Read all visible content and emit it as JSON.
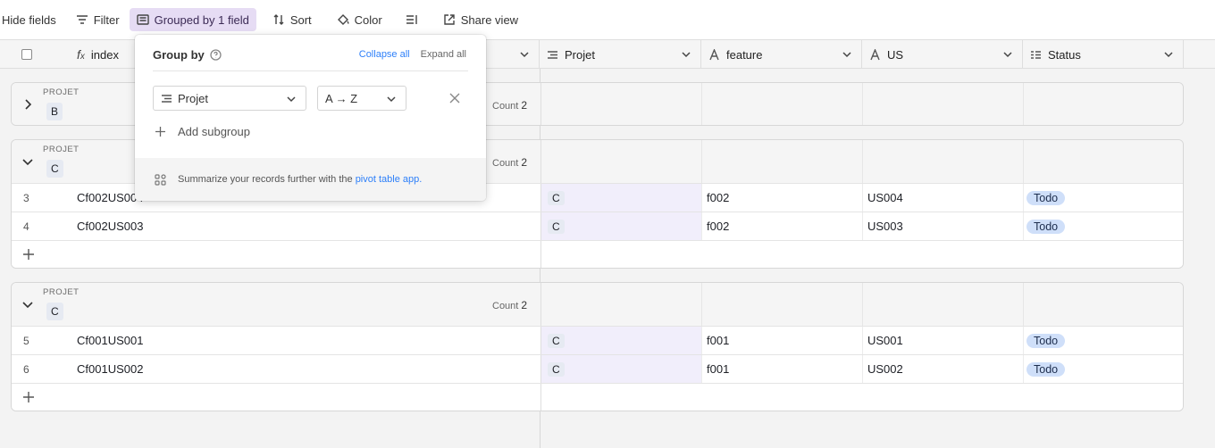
{
  "toolbar": {
    "hide_fields": "Hide fields",
    "filter": "Filter",
    "grouped": "Grouped by 1 field",
    "sort": "Sort",
    "color": "Color",
    "share": "Share view"
  },
  "columns": {
    "index": "index",
    "projet": "Projet",
    "feature": "feature",
    "us": "US",
    "status": "Status"
  },
  "groups": [
    {
      "title": "PROJET",
      "value": "B",
      "count_label": "Count",
      "count": "2",
      "rows": []
    },
    {
      "title": "PROJET",
      "value": "C",
      "count_label": "Count",
      "count": "2",
      "rows": [
        {
          "num": "3",
          "index": "Cf002US004",
          "projet": "C",
          "feature": "f002",
          "us": "US004",
          "status": "Todo"
        },
        {
          "num": "4",
          "index": "Cf002US003",
          "projet": "C",
          "feature": "f002",
          "us": "US003",
          "status": "Todo"
        }
      ]
    },
    {
      "title": "PROJET",
      "value": "C",
      "count_label": "Count",
      "count": "2",
      "rows": [
        {
          "num": "5",
          "index": "Cf001US001",
          "projet": "C",
          "feature": "f001",
          "us": "US001",
          "status": "Todo"
        },
        {
          "num": "6",
          "index": "Cf001US002",
          "projet": "C",
          "feature": "f001",
          "us": "US002",
          "status": "Todo"
        }
      ]
    }
  ],
  "popup": {
    "title": "Group by",
    "collapse_all": "Collapse all",
    "expand_all": "Expand all",
    "field": "Projet",
    "order": "A → Z",
    "add_subgroup": "Add subgroup",
    "footer_text": "Summarize your records further with the ",
    "footer_link": "pivot table app."
  },
  "colors": {
    "accent_active": "#e6dcf4",
    "status_pill": "#cfdff9",
    "link": "#2d7ff9"
  }
}
